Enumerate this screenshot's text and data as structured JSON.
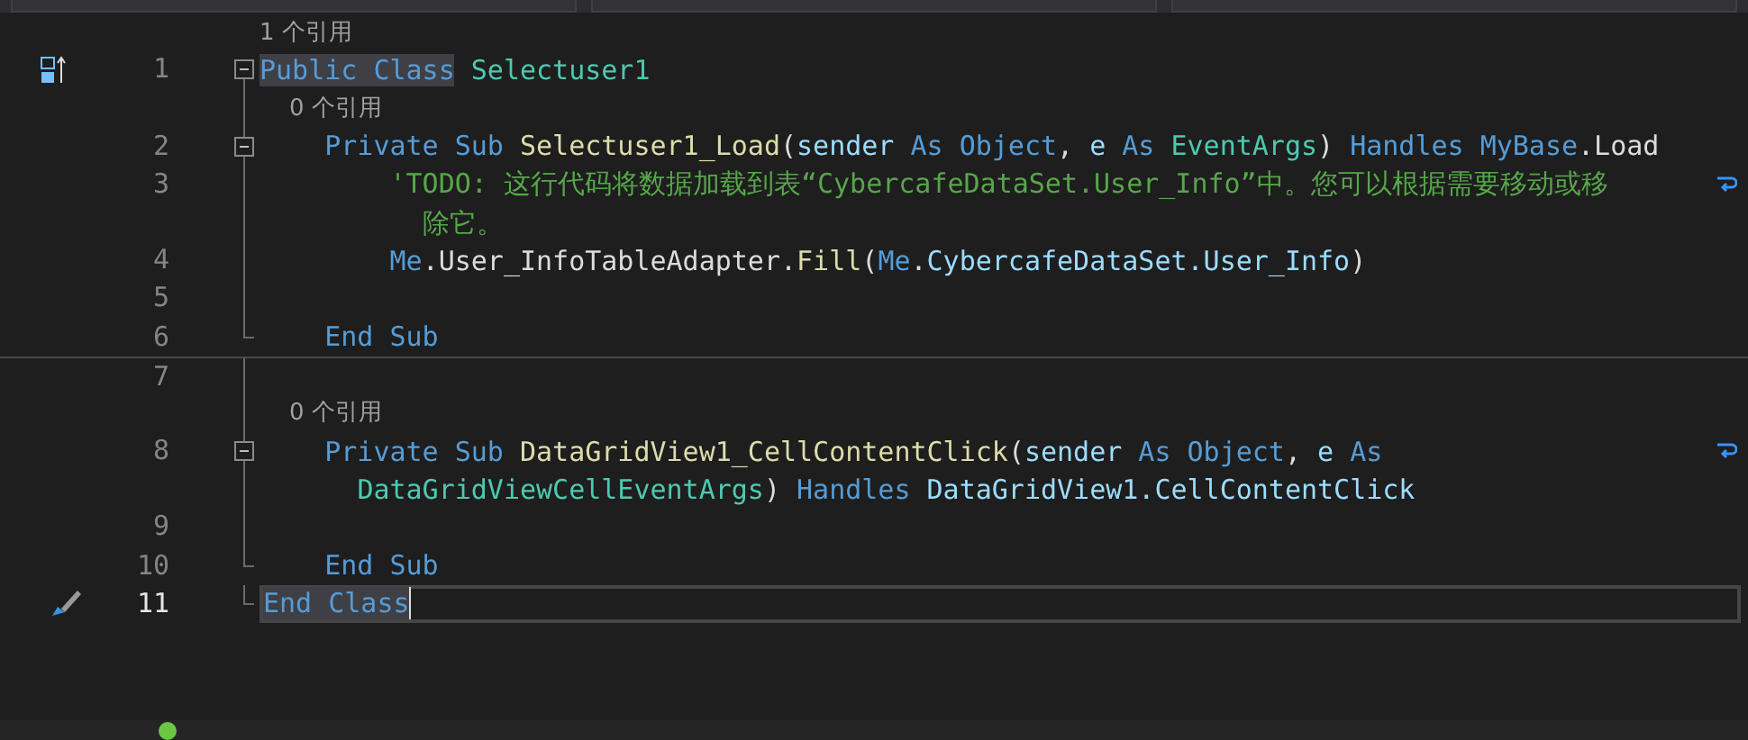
{
  "editor": {
    "lines": [
      {
        "kind": "lens",
        "text": "1 个引用"
      },
      {
        "kind": "class",
        "number": "1",
        "current": false,
        "wrapped": false,
        "collapsible": true,
        "block_end": false,
        "separator_above": false,
        "tokens": [
          {
            "kind": "keyword-hl",
            "text": "Public Class"
          },
          {
            "kind": "type",
            "text": " Selectuser1"
          }
        ],
        "children": [
          {
            "kind": "lens",
            "text": "0 个引用"
          },
          {
            "kind": "code",
            "number": "2",
            "current": false,
            "wrapped": false,
            "collapsible": true,
            "block_end": false,
            "separator_above": false,
            "tokens": [
              {
                "kind": "keyword",
                "text": "Private Sub "
              },
              {
                "kind": "method",
                "text": "Selectuser1_Load"
              },
              {
                "kind": "plain",
                "text": "("
              },
              {
                "kind": "param",
                "text": "sender"
              },
              {
                "kind": "keyword",
                "text": " As Object"
              },
              {
                "kind": "plain",
                "text": ", "
              },
              {
                "kind": "param",
                "text": "e"
              },
              {
                "kind": "keyword",
                "text": " As "
              },
              {
                "kind": "type",
                "text": "EventArgs"
              },
              {
                "kind": "plain",
                "text": ") "
              },
              {
                "kind": "keyword",
                "text": "Handles MyBase"
              },
              {
                "kind": "plain",
                "text": ".Load"
              }
            ],
            "children": [
              {
                "kind": "code",
                "number": "3",
                "current": false,
                "wrapped": true,
                "collapsible": false,
                "block_end": false,
                "separator_above": false,
                "tokens": [
                  {
                    "kind": "comment",
                    "text": "'TODO: 这行代码将数据加载到表“CybercafeDataSet.User_Info”中。您可以根据需要移动或移"
                  }
                ],
                "continuation": [
                  {
                    "kind": "comment",
                    "text": "除它。"
                  }
                ]
              },
              {
                "kind": "code",
                "number": "4",
                "current": false,
                "wrapped": false,
                "collapsible": false,
                "block_end": false,
                "separator_above": false,
                "tokens": [
                  {
                    "kind": "keyword",
                    "text": "Me"
                  },
                  {
                    "kind": "plain",
                    "text": ".User_InfoTableAdapter."
                  },
                  {
                    "kind": "method",
                    "text": "Fill"
                  },
                  {
                    "kind": "plain",
                    "text": "("
                  },
                  {
                    "kind": "keyword",
                    "text": "Me"
                  },
                  {
                    "kind": "plain",
                    "text": "."
                  },
                  {
                    "kind": "ident",
                    "text": "CybercafeDataSet.User_Info"
                  },
                  {
                    "kind": "plain",
                    "text": ")"
                  }
                ]
              },
              {
                "kind": "code",
                "number": "5",
                "current": false,
                "wrapped": false,
                "collapsible": false,
                "block_end": false,
                "separator_above": false
              }
            ]
          },
          {
            "kind": "code",
            "number": "6",
            "current": false,
            "wrapped": false,
            "collapsible": false,
            "block_end": true,
            "separator_above": false,
            "tokens": [
              {
                "kind": "keyword",
                "text": "End Sub"
              }
            ]
          },
          {
            "kind": "code",
            "number": "7",
            "current": false,
            "wrapped": false,
            "collapsible": false,
            "block_end": false,
            "separator_above": true
          },
          {
            "kind": "lens",
            "text": "0 个引用"
          },
          {
            "kind": "code",
            "number": "8",
            "current": false,
            "wrapped": true,
            "collapsible": true,
            "block_end": false,
            "separator_above": false,
            "tokens": [
              {
                "kind": "keyword",
                "text": "Private Sub "
              },
              {
                "kind": "method",
                "text": "DataGridView1_CellContentClick"
              },
              {
                "kind": "plain",
                "text": "("
              },
              {
                "kind": "param",
                "text": "sender"
              },
              {
                "kind": "keyword",
                "text": " As Object"
              },
              {
                "kind": "plain",
                "text": ", "
              },
              {
                "kind": "param",
                "text": "e"
              },
              {
                "kind": "keyword",
                "text": " As"
              }
            ],
            "continuation": [
              {
                "kind": "type",
                "text": "DataGridViewCellEventArgs"
              },
              {
                "kind": "plain",
                "text": ") "
              },
              {
                "kind": "keyword",
                "text": "Handles "
              },
              {
                "kind": "ident",
                "text": "DataGridView1.CellContentClick"
              }
            ],
            "children": [
              {
                "kind": "code",
                "number": "9",
                "current": false,
                "wrapped": false,
                "collapsible": false,
                "block_end": false,
                "separator_above": false
              }
            ]
          },
          {
            "kind": "code",
            "number": "10",
            "current": false,
            "wrapped": false,
            "collapsible": false,
            "block_end": true,
            "separator_above": false,
            "tokens": [
              {
                "kind": "keyword",
                "text": "End Sub"
              }
            ]
          }
        ]
      },
      {
        "kind": "code",
        "number": "11",
        "current": true,
        "wrapped": false,
        "collapsible": false,
        "block_end": true,
        "separator_above": false,
        "tokens": [
          {
            "kind": "keyword-hl",
            "text": "End Class"
          }
        ]
      }
    ]
  }
}
